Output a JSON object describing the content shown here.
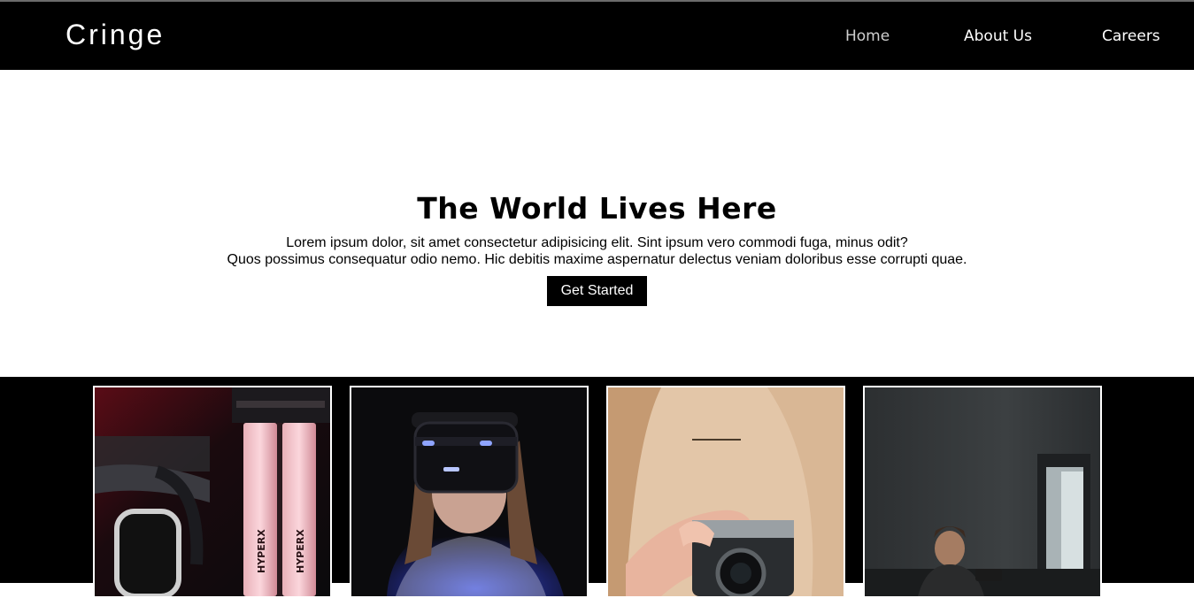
{
  "header": {
    "brand": "Cringe",
    "nav": [
      {
        "label": "Home",
        "active": true
      },
      {
        "label": "About Us",
        "active": false
      },
      {
        "label": "Careers",
        "active": false
      }
    ]
  },
  "hero": {
    "title": "The World Lives Here",
    "text_line1": "Lorem ipsum dolor, sit amet consectetur adipisicing elit. Sint ipsum vero commodi fuga, minus odit?",
    "text_line2": "Quos possimus consequatur odio nemo. Hic debitis maxime aspernatur delectus veniam doloribus esse corrupti quae.",
    "cta_label": "Get Started"
  },
  "gallery": {
    "images": [
      {
        "name": "pc-hardware-image",
        "subject": "RAM modules inside a PC case",
        "label_text": "HYPERX"
      },
      {
        "name": "vr-headset-image",
        "subject": "Person wearing a VR headset"
      },
      {
        "name": "camera-image",
        "subject": "Person holding a camera"
      },
      {
        "name": "person-room-image",
        "subject": "Person sitting in a dark room"
      }
    ]
  },
  "colors": {
    "navbar_bg": "#000000",
    "hero_bg": "#ffffff",
    "gallery_bg": "#000000",
    "card_border": "#ffffff"
  }
}
